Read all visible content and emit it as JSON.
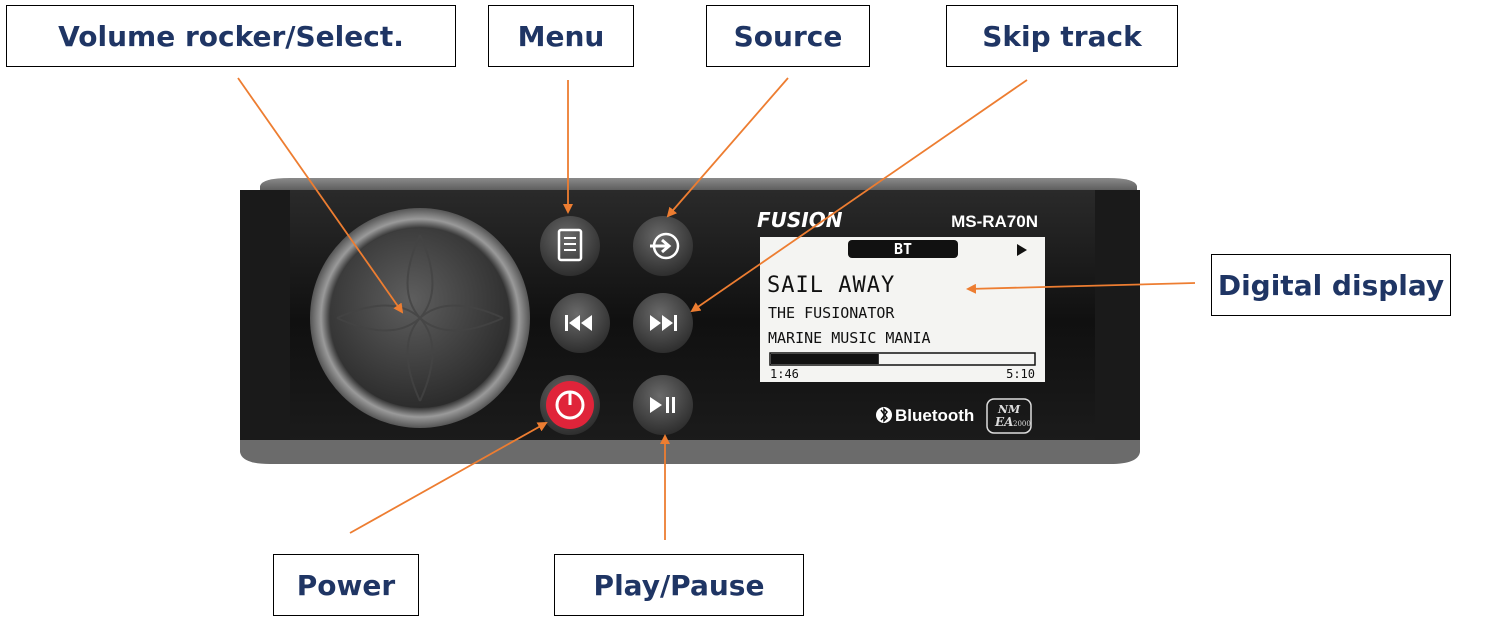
{
  "callouts": {
    "volume": "Volume rocker/Select.",
    "menu": "Menu",
    "source": "Source",
    "skip": "Skip track",
    "display": "Digital display",
    "power": "Power",
    "play": "Play/Pause"
  },
  "device": {
    "brand": "FUSION",
    "model": "MS-RA70N",
    "bluetooth_label": "Bluetooth",
    "nmea_top": "NM",
    "nmea_mid": "EA",
    "nmea_num": "2000"
  },
  "screen": {
    "source": "BT",
    "track": "SAIL AWAY",
    "artist": "THE FUSIONATOR",
    "album": "MARINE MUSIC MANIA",
    "elapsed": "1:46",
    "total": "5:10",
    "progress": 0.41
  },
  "colors": {
    "callout_text": "#1f3564",
    "arrow": "#ed7d31",
    "power_red": "#e0243a"
  }
}
